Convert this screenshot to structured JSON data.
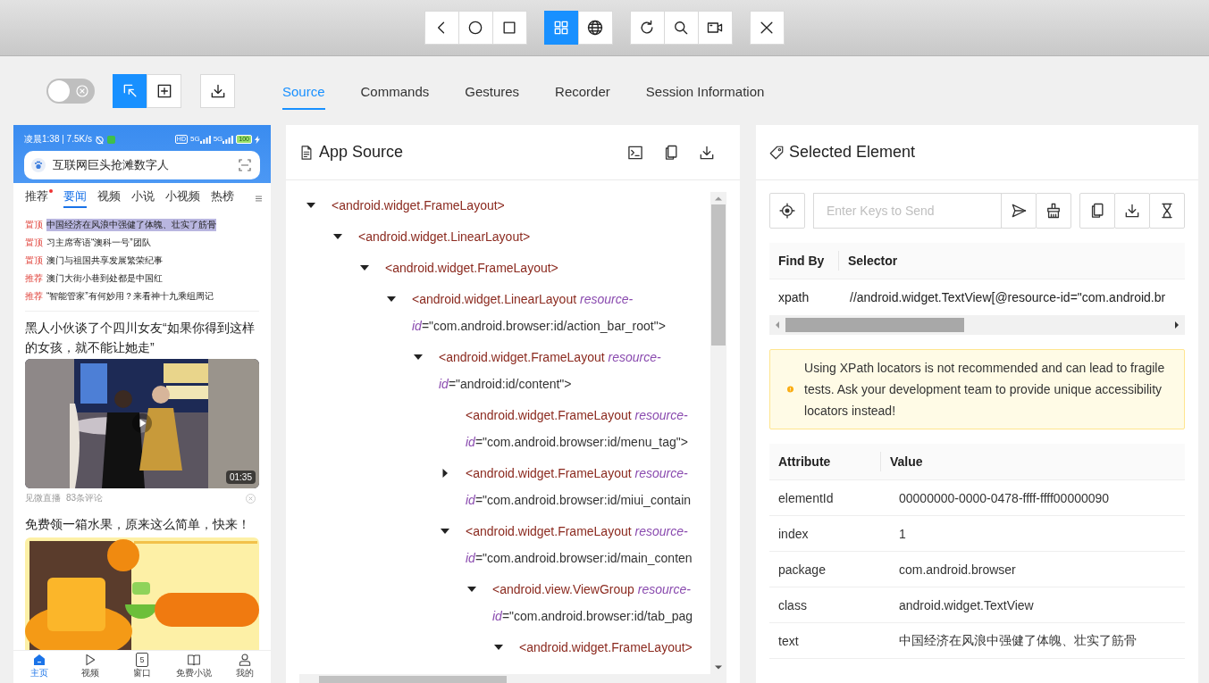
{
  "device_toolbar": {
    "groups": [
      {
        "buttons": [
          {
            "kind": "back"
          },
          {
            "kind": "home"
          },
          {
            "kind": "overview"
          }
        ]
      },
      {
        "buttons": [
          {
            "kind": "native",
            "selected": true
          },
          {
            "kind": "web",
            "selected": false
          }
        ]
      },
      {
        "buttons": [
          {
            "kind": "refresh"
          },
          {
            "kind": "search"
          },
          {
            "kind": "record"
          }
        ]
      },
      {
        "buttons": [
          {
            "kind": "quit"
          }
        ]
      }
    ]
  },
  "inspector_toolbar": {
    "toggle": {
      "on": false
    },
    "modes": [
      {
        "kind": "select",
        "selected": true
      },
      {
        "kind": "tap",
        "selected": false
      }
    ],
    "actions": [
      {
        "kind": "download"
      }
    ]
  },
  "tabs": [
    {
      "label": "Source",
      "selected": true
    },
    {
      "label": "Commands",
      "selected": false
    },
    {
      "label": "Gestures",
      "selected": false
    },
    {
      "label": "Recorder",
      "selected": false
    },
    {
      "label": "Session Information",
      "selected": false
    }
  ],
  "device_screen": {
    "status_bar": {
      "time": "凌晨1:38 | 7.5K/s",
      "network": [
        "HD",
        "5G",
        "5G"
      ],
      "battery": "100"
    },
    "search": {
      "text": "互联网巨头抢滩数字人"
    },
    "channel_tabs": [
      {
        "label": "推荐",
        "selected": false,
        "badge": true
      },
      {
        "label": "要闻",
        "selected": true,
        "badge": false
      },
      {
        "label": "视频",
        "selected": false,
        "badge": false
      },
      {
        "label": "小说",
        "selected": false,
        "badge": false
      },
      {
        "label": "小视频",
        "selected": false,
        "badge": false
      },
      {
        "label": "热榜",
        "selected": false,
        "badge": false
      }
    ],
    "headlines": [
      {
        "tag": "置顶",
        "text": "中国经济在风浪中强健了体魄、壮实了筋骨",
        "selected": true
      },
      {
        "tag": "置顶",
        "text": "习主席寄语“澳科一号”团队",
        "selected": false
      },
      {
        "tag": "置顶",
        "text": "澳门与祖国共享发展繁荣纪事",
        "selected": false
      },
      {
        "tag": "推荐",
        "text": "澳门大街小巷到处都是中国红",
        "selected": false
      },
      {
        "tag": "推荐",
        "text": "“智能管家”有何妙用？来看神十九乘组周记",
        "selected": false
      }
    ],
    "articles": [
      {
        "kind": "video",
        "title": "黑人小伙谈了个四川女友“如果你得到这样的女孩，就不能让她走”",
        "duration": "01:35",
        "source": "见微直播",
        "comments": "83条评论"
      },
      {
        "kind": "ad",
        "title": "免费领一箱水果，原来这么简单，快来！"
      }
    ],
    "bottom_nav": [
      {
        "kind": "home",
        "label": "主页",
        "selected": true
      },
      {
        "kind": "video",
        "label": "视频",
        "selected": false
      },
      {
        "kind": "tabs",
        "label": "窗口",
        "count": "5",
        "selected": false
      },
      {
        "kind": "book",
        "label": "免费小说",
        "selected": false
      },
      {
        "kind": "profile",
        "label": "我的",
        "selected": false
      }
    ]
  },
  "app_source": {
    "title": "App Source",
    "tree": [
      {
        "kind": "branch",
        "expanded": true,
        "tag": "<android.widget.FrameLayout>",
        "children": [
          {
            "kind": "branch",
            "expanded": true,
            "tag": "<android.widget.LinearLayout>",
            "children": [
              {
                "kind": "branch",
                "expanded": true,
                "tag": "<android.widget.FrameLayout>",
                "children": [
                  {
                    "kind": "branch",
                    "expanded": true,
                    "tag": "<android.widget.LinearLayout",
                    "attribute": "resource-id",
                    "value": "=\"com.android.browser:id/action_bar_root\">",
                    "children": [
                      {
                        "kind": "branch",
                        "expanded": true,
                        "tag": "<android.widget.FrameLayout",
                        "attribute": "resource-id",
                        "value": "=\"android:id/content\">",
                        "children": [
                          {
                            "kind": "leaf",
                            "tag": "<android.widget.FrameLayout",
                            "attribute": "resource-id",
                            "value": "=\"com.android.browser:id/menu_tag\">"
                          },
                          {
                            "kind": "branch",
                            "expanded": false,
                            "tag": "<android.widget.FrameLayout",
                            "attribute": "resource-id",
                            "value": "=\"com.android.browser:id/miui_contain"
                          },
                          {
                            "kind": "branch",
                            "expanded": true,
                            "tag": "<android.widget.FrameLayout",
                            "attribute": "resource-id",
                            "value": "=\"com.android.browser:id/main_conten",
                            "children": [
                              {
                                "kind": "branch",
                                "expanded": true,
                                "tag": "<android.view.ViewGroup",
                                "attribute": "resource-id",
                                "value": "=\"com.android.browser:id/tab_pag",
                                "children": [
                                  {
                                    "kind": "branch",
                                    "expanded": true,
                                    "tag": "<android.widget.FrameLayout>"
                                  }
                                ]
                              }
                            ]
                          }
                        ]
                      }
                    ]
                  }
                ]
              }
            ]
          }
        ]
      }
    ]
  },
  "selected_element": {
    "title": "Selected Element",
    "send_keys": {
      "placeholder": "Enter Keys to Send"
    },
    "selectors": {
      "columns": [
        "Find By",
        "Selector"
      ],
      "rows": [
        {
          "find_by": "xpath",
          "selector": "//android.widget.TextView[@resource-id=\"com.android.br"
        }
      ]
    },
    "warning": "Using XPath locators is not recommended and can lead to fragile tests. Ask your development team to provide unique accessibility locators instead!",
    "attributes": {
      "columns": [
        "Attribute",
        "Value"
      ],
      "rows": [
        {
          "name": "elementId",
          "value": "00000000-0000-0478-ffff-ffff00000090"
        },
        {
          "name": "index",
          "value": "1"
        },
        {
          "name": "package",
          "value": "com.android.browser"
        },
        {
          "name": "class",
          "value": "android.widget.TextView"
        },
        {
          "name": "text",
          "value": "中国经济在风浪中强健了体魄、壮实了筋骨"
        }
      ]
    }
  }
}
